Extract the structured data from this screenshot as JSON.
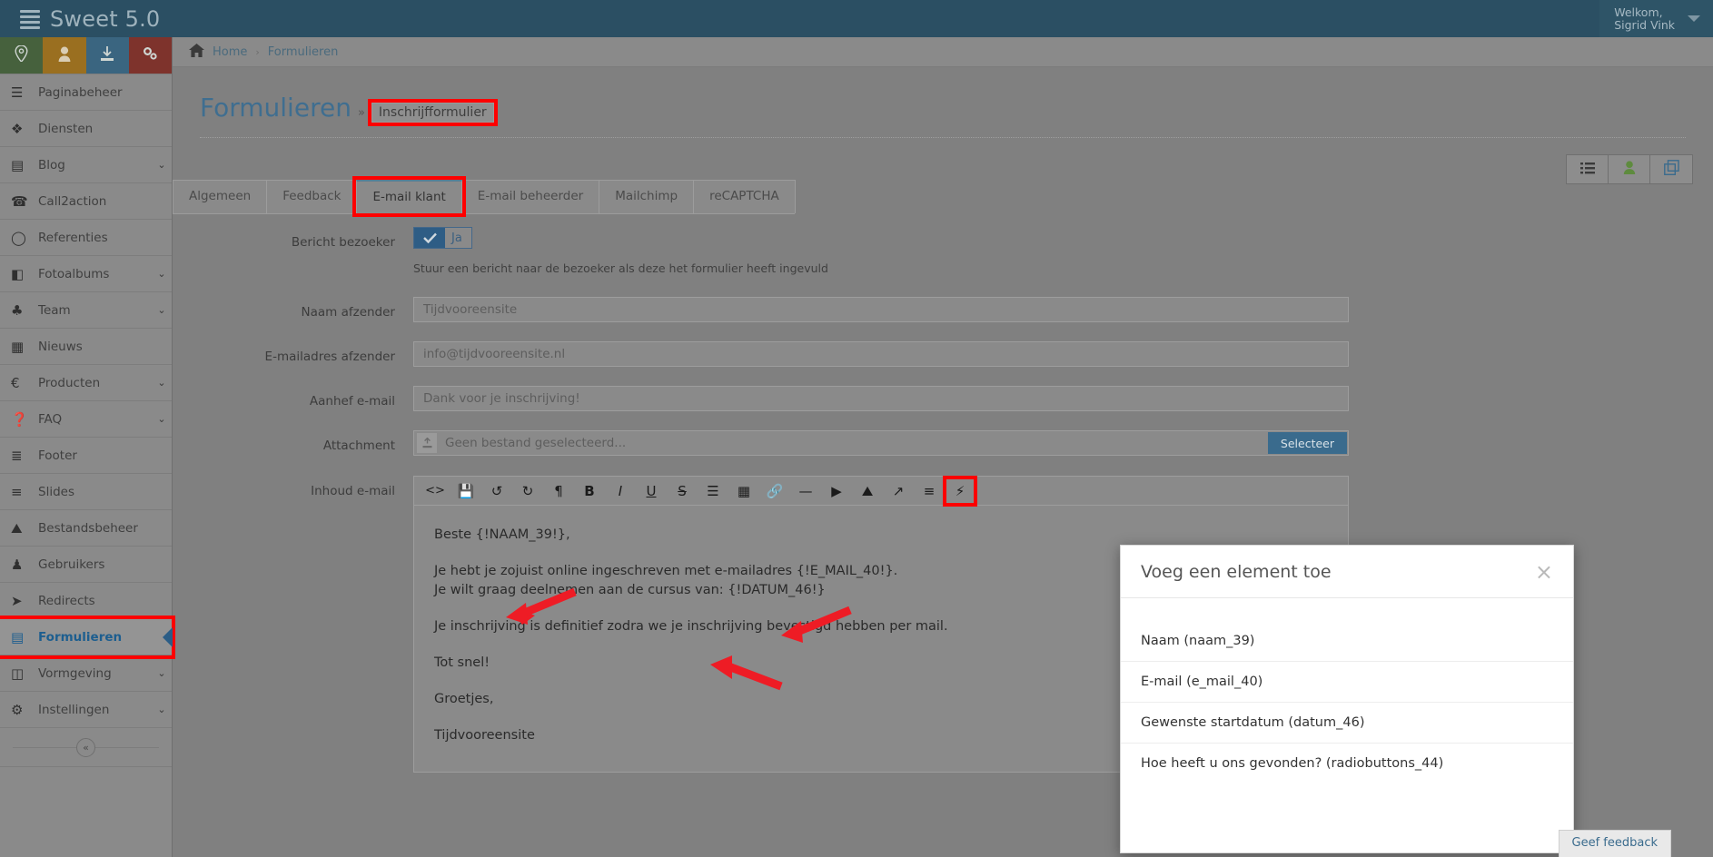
{
  "app": {
    "brand": "Sweet 5.0",
    "brand_icon": "server-stack-icon",
    "user_greeting": "Welkom,",
    "user_name": "Sigrid Vink"
  },
  "quickbar": [
    {
      "name": "location-pin-icon",
      "glyph": "⚉",
      "color": "#46613d"
    },
    {
      "name": "user-icon",
      "glyph": "♟",
      "color": "#9a6f20"
    },
    {
      "name": "download-icon",
      "glyph": "⬇",
      "color": "#3a6580"
    },
    {
      "name": "cogs-icon",
      "glyph": "⚙",
      "color": "#7e332c"
    }
  ],
  "sidebar": {
    "items": [
      {
        "label": "Paginabeheer",
        "icon": "bars-icon",
        "glyph": "☰",
        "chevron": false,
        "active": false
      },
      {
        "label": "Diensten",
        "icon": "cubes-icon",
        "glyph": "❖",
        "chevron": false,
        "active": false
      },
      {
        "label": "Blog",
        "icon": "file-text-icon",
        "glyph": "▤",
        "chevron": true,
        "active": false
      },
      {
        "label": "Call2action",
        "icon": "bullhorn-icon",
        "glyph": "☎",
        "chevron": false,
        "active": false
      },
      {
        "label": "Referenties",
        "icon": "comment-icon",
        "glyph": "◯",
        "chevron": false,
        "active": false
      },
      {
        "label": "Fotoalbums",
        "icon": "book-icon",
        "glyph": "◧",
        "chevron": true,
        "active": false
      },
      {
        "label": "Team",
        "icon": "users-icon",
        "glyph": "♣",
        "chevron": true,
        "active": false
      },
      {
        "label": "Nieuws",
        "icon": "newspaper-icon",
        "glyph": "▦",
        "chevron": false,
        "active": false
      },
      {
        "label": "Producten",
        "icon": "euro-icon",
        "glyph": "€",
        "chevron": true,
        "active": false
      },
      {
        "label": "FAQ",
        "icon": "question-circle-icon",
        "glyph": "❓",
        "chevron": true,
        "active": false
      },
      {
        "label": "Footer",
        "icon": "list-alt-icon",
        "glyph": "≣",
        "chevron": false,
        "active": false
      },
      {
        "label": "Slides",
        "icon": "sliders-icon",
        "glyph": "≡",
        "chevron": false,
        "active": false
      },
      {
        "label": "Bestandsbeheer",
        "icon": "image-icon",
        "glyph": "⛰",
        "chevron": false,
        "active": false
      },
      {
        "label": "Gebruikers",
        "icon": "user-icon",
        "glyph": "♟",
        "chevron": false,
        "active": false
      },
      {
        "label": "Redirects",
        "icon": "arrow-circle-right-icon",
        "glyph": "➤",
        "chevron": false,
        "active": false
      },
      {
        "label": "Formulieren",
        "icon": "form-icon",
        "glyph": "▤",
        "chevron": false,
        "active": true
      },
      {
        "label": "Vormgeving",
        "icon": "columns-icon",
        "glyph": "◫",
        "chevron": true,
        "active": false
      },
      {
        "label": "Instellingen",
        "icon": "gear-icon",
        "glyph": "⚙",
        "chevron": true,
        "active": false
      }
    ],
    "collapse_icon": "double-chevron-left-icon",
    "collapse_glyph": "«"
  },
  "breadcrumb": {
    "home_icon": "home-icon",
    "items": [
      "Home",
      "Formulieren"
    ],
    "separator": "›"
  },
  "page": {
    "title": "Formulieren",
    "title_separator": "»",
    "subtitle": "Inschrijfformulier"
  },
  "top_actions": [
    {
      "name": "list-view-button",
      "glyph": "≣"
    },
    {
      "name": "user-button",
      "glyph": "♟"
    },
    {
      "name": "duplicate-button",
      "glyph": "❐"
    }
  ],
  "tabs": [
    {
      "label": "Algemeen",
      "active": false
    },
    {
      "label": "Feedback",
      "active": false
    },
    {
      "label": "E-mail klant",
      "active": true
    },
    {
      "label": "E-mail beheerder",
      "active": false
    },
    {
      "label": "Mailchimp",
      "active": false
    },
    {
      "label": "reCAPTCHA",
      "active": false
    }
  ],
  "form": {
    "bericht_bezoeker": {
      "label": "Bericht bezoeker",
      "checkbox_checked": true,
      "checkbox_label": "Ja",
      "help": "Stuur een bericht naar de bezoeker als deze het formulier heeft ingevuld"
    },
    "naam_afzender": {
      "label": "Naam afzender",
      "value": "Tijdvooreensite"
    },
    "email_afzender": {
      "label": "E-mailadres afzender",
      "value": "info@tijdvooreensite.nl"
    },
    "aanhef_email": {
      "label": "Aanhef e-mail",
      "value": "Dank voor je inschrijving!"
    },
    "attachment": {
      "label": "Attachment",
      "placeholder": "Geen bestand geselecteerd...",
      "button": "Selecteer",
      "icon": "upload-icon"
    },
    "inhoud_email": {
      "label": "Inhoud e-mail"
    }
  },
  "editor": {
    "toolbar": [
      {
        "name": "source-code-icon",
        "glyph": "<>"
      },
      {
        "name": "save-icon",
        "glyph": "💾"
      },
      {
        "name": "undo-icon",
        "glyph": "↺"
      },
      {
        "name": "redo-icon",
        "glyph": "↻"
      },
      {
        "name": "paragraph-icon",
        "glyph": "¶"
      },
      {
        "name": "bold-icon",
        "glyph": "B"
      },
      {
        "name": "italic-icon",
        "glyph": "I"
      },
      {
        "name": "underline-icon",
        "glyph": "U"
      },
      {
        "name": "strikethrough-icon",
        "glyph": "S"
      },
      {
        "name": "unordered-list-icon",
        "glyph": "☰"
      },
      {
        "name": "table-icon",
        "glyph": "▦"
      },
      {
        "name": "link-icon",
        "glyph": "🔗"
      },
      {
        "name": "horizontal-rule-icon",
        "glyph": "—"
      },
      {
        "name": "video-icon",
        "glyph": "▶"
      },
      {
        "name": "image-icon",
        "glyph": "⛰"
      },
      {
        "name": "fullscreen-icon",
        "glyph": "↗"
      },
      {
        "name": "align-icon",
        "glyph": "≡"
      },
      {
        "name": "insert-element-icon",
        "glyph": "⚡",
        "highlighted": true
      }
    ],
    "body": [
      {
        "text": "Beste {!NAAM_39!},",
        "spacing": "normal"
      },
      {
        "text": "Je hebt je zojuist online ingeschreven met e-mailadres {!E_MAIL_40!}.",
        "spacing": "tight"
      },
      {
        "text": "Je wilt graag deelnemen aan de cursus van: {!DATUM_46!}",
        "spacing": "normal"
      },
      {
        "text": "Je inschrijving is definitief zodra we je inschrijving bevestigd hebben per mail.",
        "spacing": "normal"
      },
      {
        "text": "Tot snel!",
        "spacing": "normal"
      },
      {
        "text": "Groetjes,",
        "spacing": "normal"
      },
      {
        "text": "Tijdvooreensite",
        "spacing": "normal"
      }
    ]
  },
  "modal": {
    "title": "Voeg een element toe",
    "close_icon": "close-icon",
    "close_glyph": "×",
    "items": [
      "Naam (naam_39)",
      "E-mail (e_mail_40)",
      "Gewenste startdatum (datum_46)",
      "Hoe heeft u ons gevonden? (radiobuttons_44)"
    ]
  },
  "feedback_tab": {
    "label": "Geef feedback"
  },
  "colors": {
    "topbar": "#2b4f63",
    "sidebar": "#8a8a8a",
    "accent_blue": "#3a6b8d",
    "highlight_red": "#fe0000",
    "active_link": "#1d5e8f"
  }
}
